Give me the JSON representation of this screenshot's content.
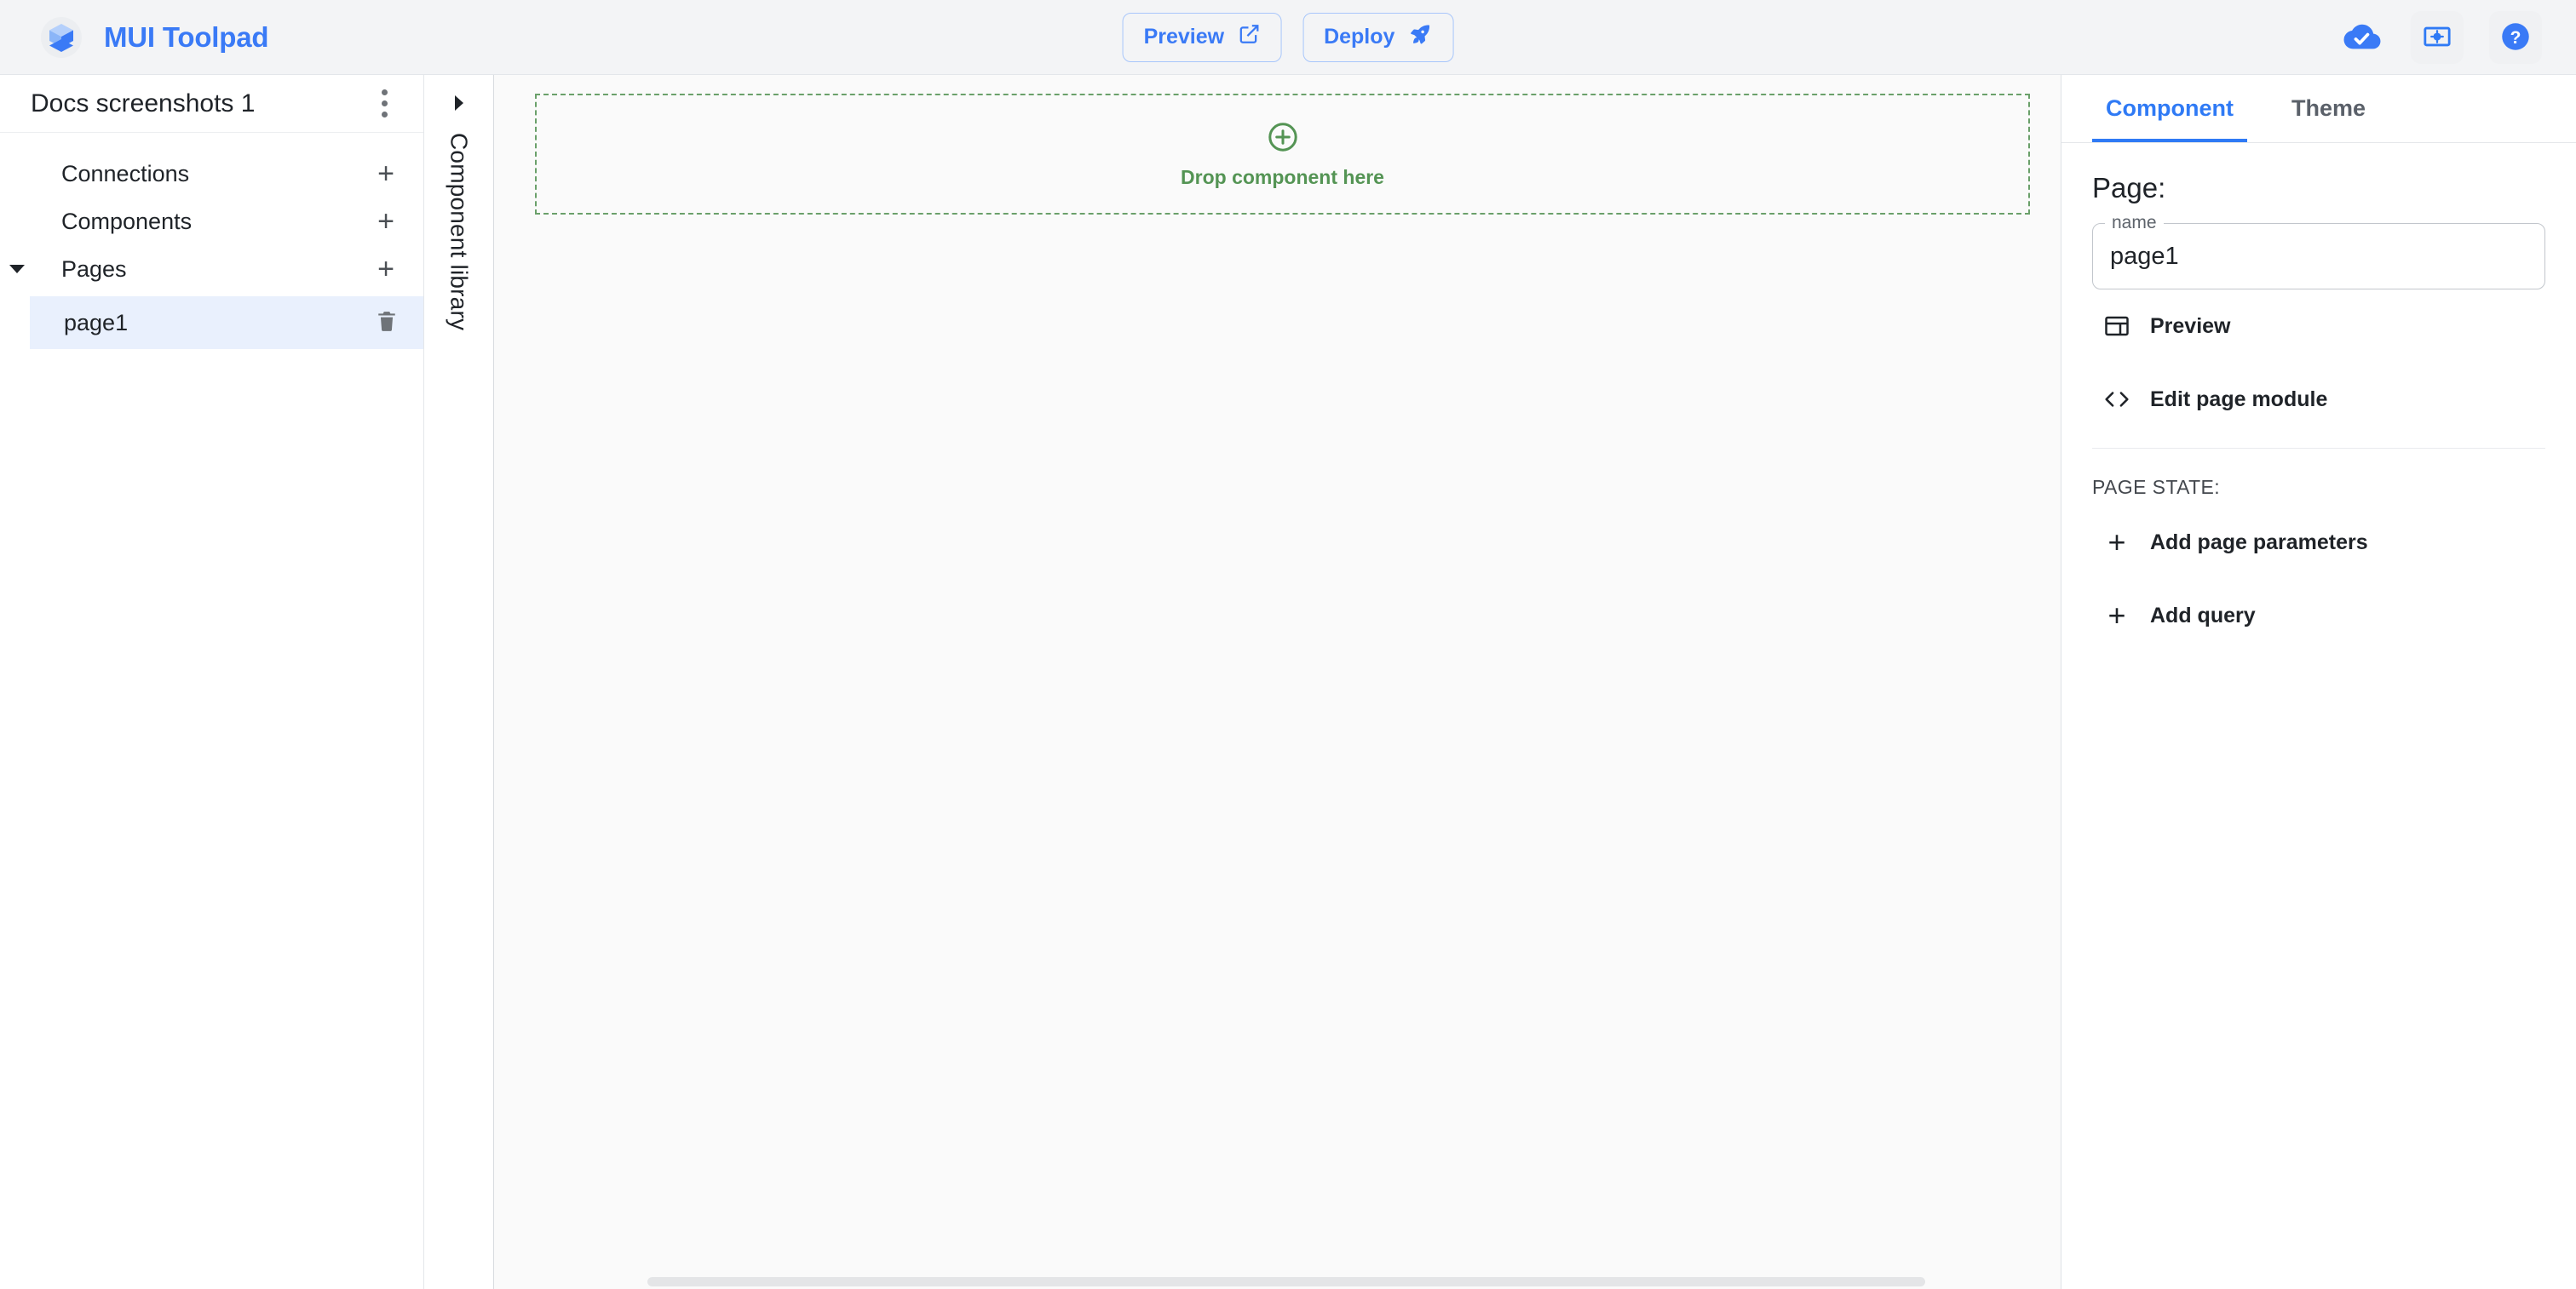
{
  "header": {
    "brand": "MUI Toolpad",
    "logo_icon": "mui-toolpad-logo-icon",
    "preview_label": "Preview",
    "preview_icon": "open-in-new-icon",
    "deploy_label": "Deploy",
    "deploy_icon": "rocket-icon",
    "status_icon": "cloud-done-icon",
    "theme_icon": "brightness-panel-icon",
    "help_icon": "help-circle-icon",
    "brand_color": "#3a7af6",
    "background": "#f3f4f6"
  },
  "explorer": {
    "title": "Docs screenshots 1",
    "more_icon": "more-vertical-icon",
    "nodes": [
      {
        "label": "Connections",
        "add_icon": "plus-icon",
        "expandable": false
      },
      {
        "label": "Components",
        "add_icon": "plus-icon",
        "expandable": false
      },
      {
        "label": "Pages",
        "add_icon": "plus-icon",
        "expandable": true,
        "expand_icon": "caret-down-icon"
      }
    ],
    "page_item": {
      "label": "page1",
      "delete_icon": "trash-icon",
      "selected": true,
      "selected_background": "#e9f0fd"
    }
  },
  "rail": {
    "label": "Component library",
    "expand_icon": "caret-right-icon"
  },
  "canvas": {
    "dropzone": {
      "label": "Drop component here",
      "icon": "plus-circle-icon",
      "color": "#549454",
      "border_color": "#6aa06a"
    },
    "scrollbar": "horizontal-scrollbar"
  },
  "inspector": {
    "tabs": [
      {
        "label": "Component",
        "active": true
      },
      {
        "label": "Theme",
        "active": false
      }
    ],
    "active_tab_color": "#2f7af5",
    "heading": "Page:",
    "name_field": {
      "label": "name",
      "value": "page1"
    },
    "actions": [
      {
        "label": "Preview",
        "icon": "web-layout-icon"
      },
      {
        "label": "Edit page module",
        "icon": "code-brackets-icon"
      }
    ],
    "page_state_caption": "PAGE STATE:",
    "state_actions": [
      {
        "label": "Add page parameters",
        "icon": "plus-icon"
      },
      {
        "label": "Add query",
        "icon": "plus-icon"
      }
    ]
  }
}
